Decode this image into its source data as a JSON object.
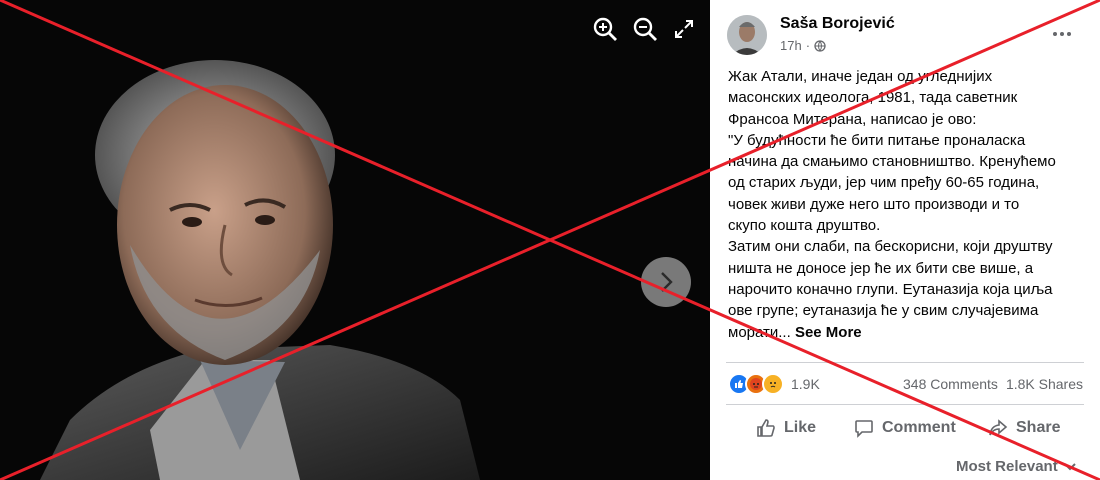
{
  "viewer": {
    "zoom_in_icon": "zoom-in-icon",
    "zoom_out_icon": "zoom-out-icon",
    "fullscreen_icon": "expand-icon",
    "next_icon": "chevron-right-icon"
  },
  "post": {
    "author": "Saša Borojević",
    "time": "17h",
    "privacy_icon": "globe-icon",
    "text_lines": [
      "Жак Атали, иначе један од угледнијих",
      "масонских идеолога, 1981, тада саветник",
      "Франсоа Митерана, написао је ово:",
      "\"У будућности ће бити питање проналаска",
      "начина да смањимо становништво. Кренућемо",
      "од старих људи, јер чим пређу 60-65 година,",
      "човек живи дуже него што производи и то",
      "скупо кошта друштво.",
      "Затим они слаби, па бескорисни, који друштву",
      "ништа не доносе јер ће их бити све више, а",
      "нарочито коначно глупи. Еутаназија која циља",
      "ове групе; еутаназија ће у свим случајевима"
    ],
    "last_line": "морати...",
    "see_more": "See More"
  },
  "stats": {
    "reaction_icons": [
      "like-reaction-icon",
      "angry-reaction-icon",
      "sad-reaction-icon"
    ],
    "reactions": "1.9K",
    "comments": "348 Comments",
    "shares": "1.8K Shares"
  },
  "actions": {
    "like": "Like",
    "comment": "Comment",
    "share": "Share"
  },
  "comments_sort": "Most Relevant",
  "colors": {
    "cross_red": "#e8202a",
    "like_blue": "#1877f2",
    "text_gray": "#65676b"
  }
}
